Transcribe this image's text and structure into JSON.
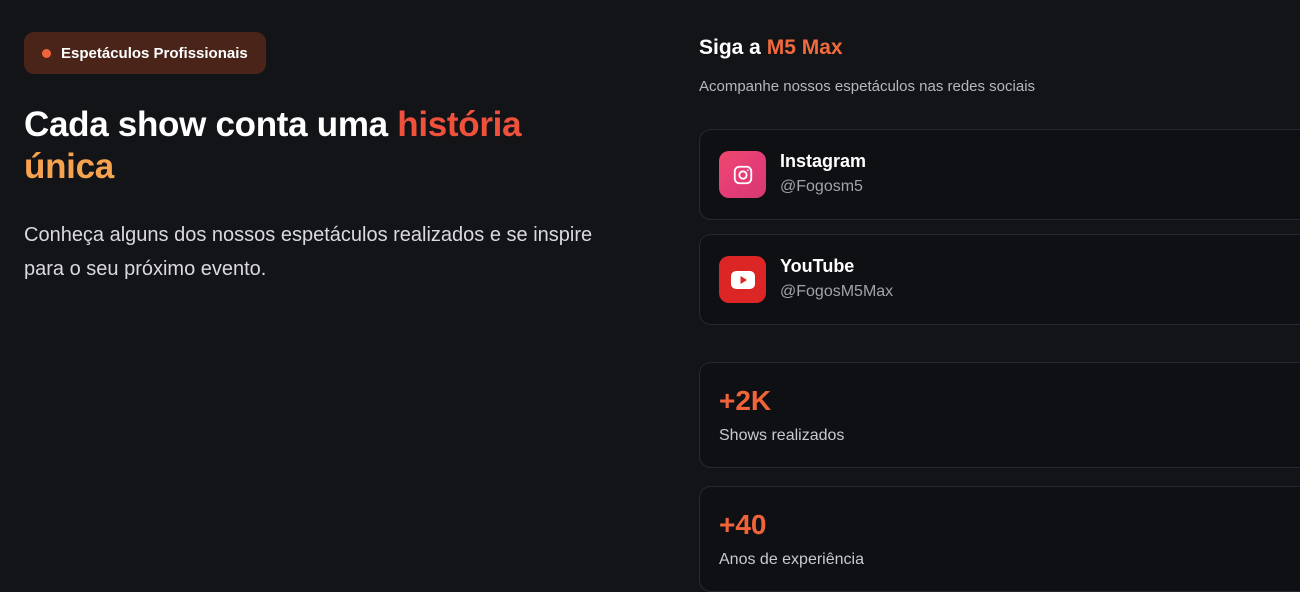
{
  "badge": {
    "label": "Espetáculos Profissionais"
  },
  "hero": {
    "title_part1": "Cada show conta uma ",
    "title_highlight1": "história",
    "title_highlight2": "única",
    "description": "Conheça alguns dos nossos espetáculos realizados e se inspire para o seu próximo evento."
  },
  "follow": {
    "title_prefix": "Siga a ",
    "brand": "M5 Max",
    "subtitle": "Acompanhe nossos espetáculos nas redes sociais"
  },
  "socials": [
    {
      "name": "Instagram",
      "handle": "@Fogosm5",
      "icon": "instagram-icon"
    },
    {
      "name": "YouTube",
      "handle": "@FogosM5Max",
      "icon": "youtube-icon"
    }
  ],
  "stats": [
    {
      "value": "+2K",
      "label": "Shows realizados"
    },
    {
      "value": "+40",
      "label": "Anos de experiência"
    }
  ],
  "colors": {
    "accent": "#f0643a",
    "highlight_red": "#f0513c",
    "highlight_orange": "#f6a24e",
    "background": "#131418",
    "instagram": "#e23b77",
    "youtube": "#dc2626"
  }
}
